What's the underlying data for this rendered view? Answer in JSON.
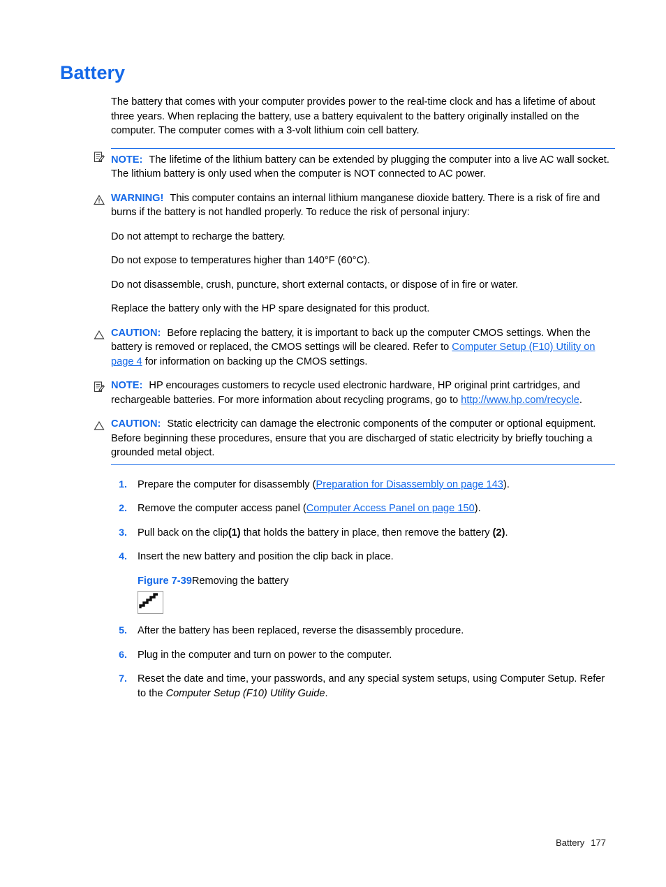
{
  "page": {
    "heading": "Battery",
    "footer_section": "Battery",
    "footer_page": "177",
    "accent_color": "#1569e8",
    "text_color": "#000000"
  },
  "intro": {
    "paragraph": "The battery that comes with your computer provides power to the real-time clock and has a lifetime of about three years. When replacing the battery, use a battery equivalent to the battery originally installed on the computer. The computer comes with a 3-volt lithium coin cell battery."
  },
  "admonitions": {
    "note1": {
      "icon": "note-icon",
      "label": "NOTE:",
      "text": "The lifetime of the lithium battery can be extended by plugging the computer into a live AC wall socket. The lithium battery is only used when the computer is NOT connected to AC power."
    },
    "warning": {
      "icon": "warning-triangle-icon",
      "label": "WARNING!",
      "text": "This computer contains an internal lithium manganese dioxide battery. There is a risk of fire and burns if the battery is not handled properly. To reduce the risk of personal injury:"
    },
    "warning_items": [
      "Do not attempt to recharge the battery.",
      "Do not expose to temperatures higher than 140°F (60°C).",
      "Do not disassemble, crush, puncture, short external contacts, or dispose of in fire or water.",
      "Replace the battery only with the HP spare designated for this product."
    ],
    "caution1": {
      "icon": "caution-triangle-icon",
      "label": "CAUTION:",
      "text_before": "Before replacing the battery, it is important to back up the computer CMOS settings. When the battery is removed or replaced, the CMOS settings will be cleared. Refer to ",
      "link": "Computer Setup (F10) Utility on page 4",
      "text_after": " for information on backing up the CMOS settings."
    },
    "note2": {
      "icon": "note-icon",
      "label": "NOTE:",
      "text_before": "HP encourages customers to recycle used electronic hardware, HP original print cartridges, and rechargeable batteries. For more information about recycling programs, go to ",
      "link": "http://www.hp.com/recycle",
      "text_after": "."
    },
    "caution2": {
      "icon": "caution-triangle-icon",
      "label": "CAUTION:",
      "text": "Static electricity can damage the electronic components of the computer or optional equipment. Before beginning these procedures, ensure that you are discharged of static electricity by briefly touching a grounded metal object."
    }
  },
  "steps": [
    {
      "num": "1.",
      "text_before": "Prepare the computer for disassembly (",
      "link": "Preparation for Disassembly on page 143",
      "text_after": ")."
    },
    {
      "num": "2.",
      "text_before": "Remove the computer access panel (",
      "link": "Computer Access Panel on page 150",
      "text_after": ")."
    },
    {
      "num": "3.",
      "text_before": "Pull back on the clip",
      "bold1": "(1)",
      "text_mid": " that holds the battery in place, then remove the battery ",
      "bold2": "(2)",
      "text_after": "."
    },
    {
      "num": "4.",
      "text": "Insert the new battery and position the clip back in place."
    },
    {
      "num": "5.",
      "text": "After the battery has been replaced, reverse the disassembly procedure."
    },
    {
      "num": "6.",
      "text": "Plug in the computer and turn on power to the computer."
    },
    {
      "num": "7.",
      "text_before": "Reset the date and time, your passwords, and any special system setups, using Computer Setup. Refer to the ",
      "italic": "Computer Setup (F10) Utility Guide",
      "text_after": "."
    }
  ],
  "figure": {
    "number": "Figure 7-39",
    "caption": "Removing the battery",
    "image": "broken-image-placeholder"
  }
}
